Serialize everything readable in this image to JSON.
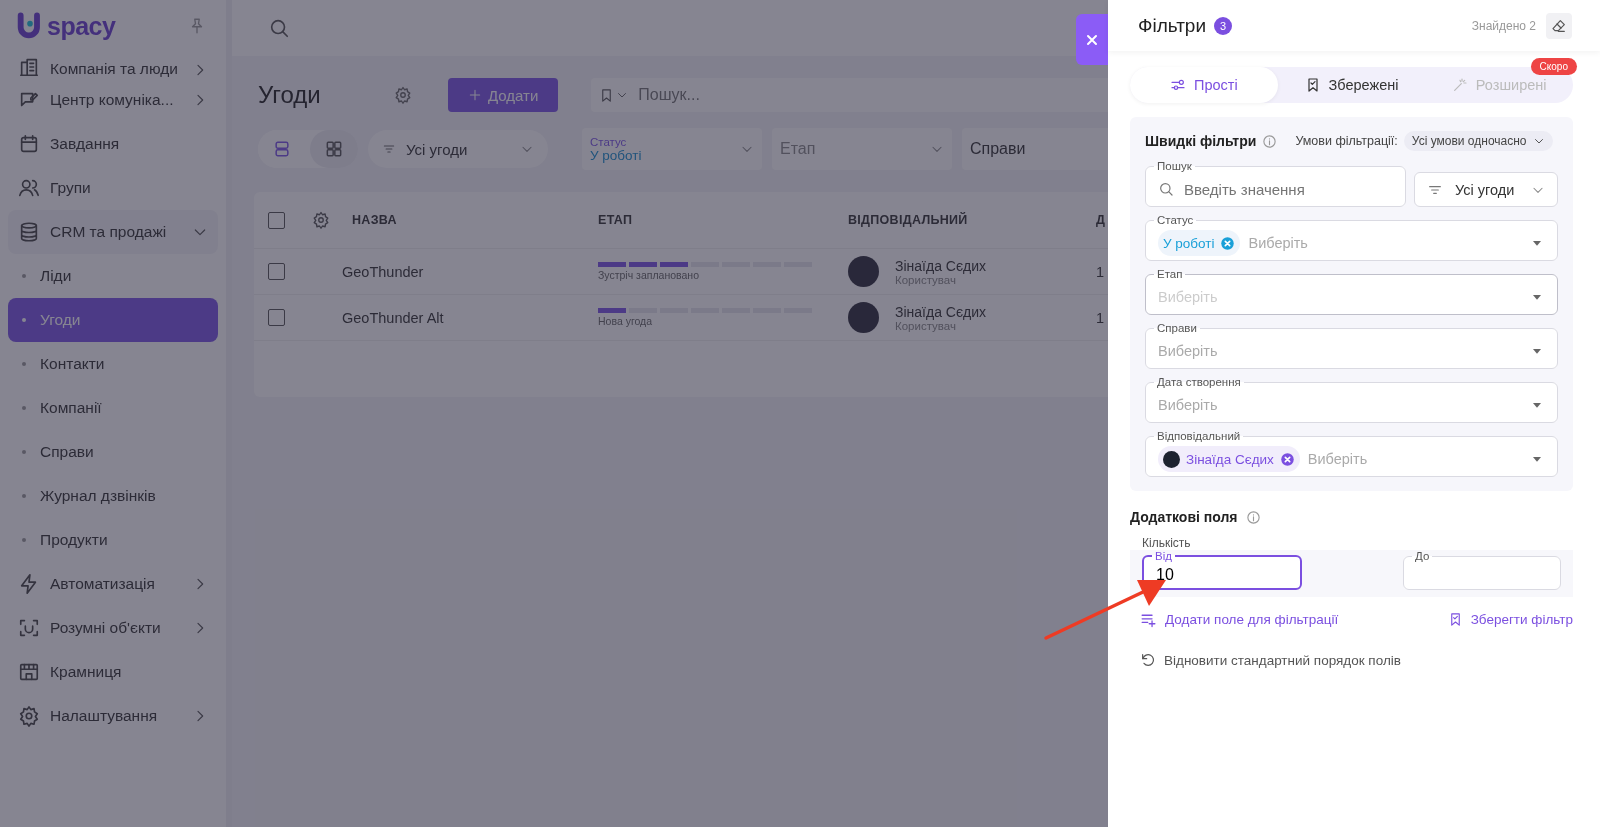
{
  "sidebar": {
    "logo": "spacy",
    "items": [
      {
        "label": "Компанія та люди",
        "kind": "group",
        "expanded": false
      },
      {
        "label": "Центр комуніка...",
        "kind": "group",
        "expanded": false
      },
      {
        "label": "Завдання",
        "kind": "link"
      },
      {
        "label": "Групи",
        "kind": "link"
      },
      {
        "label": "CRM та продажі",
        "kind": "group",
        "expanded": true,
        "children": [
          {
            "label": "Ліди",
            "selected": false
          },
          {
            "label": "Угоди",
            "selected": true
          },
          {
            "label": "Контакти",
            "selected": false
          },
          {
            "label": "Компанії",
            "selected": false
          },
          {
            "label": "Справи",
            "selected": false
          },
          {
            "label": "Журнал дзвінків",
            "selected": false
          },
          {
            "label": "Продукти",
            "selected": false
          }
        ]
      },
      {
        "label": "Автоматизація",
        "kind": "group",
        "expanded": false
      },
      {
        "label": "Розумні об'єкти",
        "kind": "group",
        "expanded": false
      },
      {
        "label": "Крамниця",
        "kind": "link"
      },
      {
        "label": "Налаштування",
        "kind": "group",
        "expanded": false
      }
    ]
  },
  "page": {
    "title": "Угоди",
    "add_button": "Додати",
    "search": {
      "placeholder": "Пошук..."
    },
    "views": [
      {
        "kind": "list",
        "selected": true
      },
      {
        "kind": "grid",
        "selected": false
      }
    ],
    "scope": "Усі угоди",
    "filters": [
      {
        "label": "Статус",
        "value": "У роботі"
      },
      {
        "placeholder": "Етап",
        "disabled": true
      },
      {
        "placeholder": "Справи",
        "disabled": false
      }
    ]
  },
  "table": {
    "select_all": {
      "checked": false
    },
    "columns": [
      "НАЗВА",
      "ЕТАП",
      "ВІДПОВІДАЛЬНИЙ",
      "Д"
    ],
    "rows": [
      {
        "checked": false,
        "name": "GeoThunder",
        "stage": "Зустріч заплановано",
        "level": 0.43,
        "owner": "Зінаїда Сєдих",
        "role": "Користувач",
        "column_4": "1"
      },
      {
        "checked": false,
        "name": "GeoThunder Alt",
        "stage": "Нова угода",
        "level": 0.14,
        "owner": "Зінаїда Сєдих",
        "role": "Користувач",
        "column_4": "1"
      }
    ]
  },
  "filter_panel": {
    "title": "Фільтри",
    "count": "3",
    "found": "Знайдено 2",
    "tabs": [
      {
        "label": "Прості",
        "selected": true,
        "disabled": false
      },
      {
        "label": "Збережені",
        "selected": false,
        "disabled": false
      },
      {
        "label": "Розширені",
        "selected": false,
        "disabled": true,
        "badge": "Скоро"
      }
    ],
    "quick": {
      "title": "Швидкі фільтри",
      "conditions_label": "Умови фільтрації:",
      "conditions": "Усі умови одночасно",
      "search": {
        "label": "Пошук",
        "placeholder": "Введіть значення"
      },
      "scope": "Усі угоди",
      "selects": [
        {
          "label": "Статус",
          "placeholder": "Виберіть",
          "disabled": false,
          "chips": [
            {
              "kind": "status",
              "text": "У роботі",
              "color": "#1aa0d8"
            }
          ]
        },
        {
          "label": "Етап",
          "placeholder": "Виберіть",
          "disabled": true
        },
        {
          "label": "Справи",
          "placeholder": "Виберіть",
          "disabled": false
        },
        {
          "label": "Дата створення",
          "placeholder": "Виберіть",
          "disabled": false
        },
        {
          "label": "Відповідальний",
          "placeholder": "Виберіть",
          "disabled": false,
          "chips": [
            {
              "kind": "user",
              "text": "Зінаїда Сєдих",
              "color": "#7b4fe0"
            }
          ]
        }
      ]
    },
    "extra": {
      "title": "Додаткові поля",
      "group": "Кількість",
      "fields": [
        {
          "label": "Від",
          "value": "10",
          "focused": true
        },
        {
          "label": "До",
          "focused": false
        }
      ]
    },
    "actions": {
      "add": "Додати поле для фільтрації",
      "save": "Зберегти фільтр",
      "reset": "Відновити стандартний порядок полів"
    }
  }
}
